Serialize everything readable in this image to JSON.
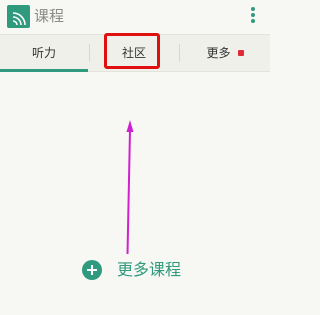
{
  "app_bar": {
    "title": "课程",
    "logo_icon": "wifi-signal-icon",
    "menu_icon": "more-vertical-icon"
  },
  "tabs": [
    {
      "label": "听力",
      "selected": true
    },
    {
      "label": "社区",
      "selected": false,
      "highlighted": true
    },
    {
      "label": "更多",
      "selected": false,
      "badge": true
    }
  ],
  "main": {
    "more_courses_label": "更多课程",
    "more_courses_icon": "plus-circle-icon"
  },
  "colors": {
    "accent": "#2f9a7e",
    "highlight": "#e01010",
    "arrow": "#d020d0",
    "badge": "#e02a3a"
  }
}
